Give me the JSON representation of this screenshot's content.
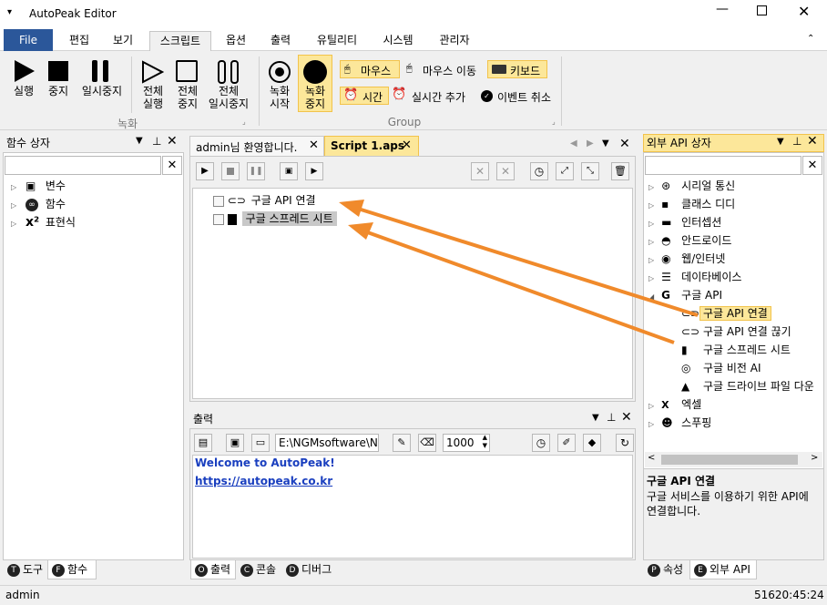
{
  "app": {
    "title": "AutoPeak Editor"
  },
  "menu": {
    "file": "File",
    "tabs": [
      "편집",
      "보기",
      "스크립트",
      "옵션",
      "출력",
      "유틸리티",
      "시스템",
      "관리자"
    ]
  },
  "ribbon": {
    "run": "실행",
    "stop": "중지",
    "pause": "일시중지",
    "run_all": [
      "전체",
      "실행"
    ],
    "stop_all": [
      "전체",
      "중지"
    ],
    "pause_all": [
      "전체",
      "일시중지"
    ],
    "record_start": [
      "녹화",
      "시작"
    ],
    "record_stop": [
      "녹화",
      "중지"
    ],
    "group_record": "녹화",
    "mouse": "마우스",
    "mouse_move": "마우스 이동",
    "keyboard": "키보드",
    "time": "시간",
    "realtime_add": "실시간 추가",
    "event_cancel": "이벤트 취소",
    "group_group": "Group"
  },
  "left_panel": {
    "title": "함수 상자",
    "items": [
      {
        "label": "변수"
      },
      {
        "label": "함수"
      },
      {
        "label": "표현식"
      }
    ],
    "tabs": {
      "tools": "도구",
      "functions": "함수",
      "tools_key": "T",
      "functions_key": "F"
    }
  },
  "editor": {
    "tabs": [
      "admin님 환영합니다.",
      "Script 1.aps"
    ],
    "items": [
      "구글 API 연결",
      "구글 스프레드 시트"
    ]
  },
  "output": {
    "title": "출력",
    "path": "E:\\NGMsoftware\\NG",
    "value": "1000",
    "welcome": "Welcome to AutoPeak!",
    "link": "https://autopeak.co.kr",
    "tabs": [
      {
        "key": "O",
        "label": "출력"
      },
      {
        "key": "C",
        "label": "콘솔"
      },
      {
        "key": "D",
        "label": "디버그"
      }
    ]
  },
  "right_panel": {
    "title": "외부 API 상자",
    "items": [
      {
        "label": "시리얼 통신",
        "icon": "serial-icon"
      },
      {
        "label": "클래스 디디",
        "icon": "class-icon"
      },
      {
        "label": "인터셉션",
        "icon": "monitor-icon"
      },
      {
        "label": "안드로이드",
        "icon": "android-icon"
      },
      {
        "label": "웹/인터넷",
        "icon": "web-icon"
      },
      {
        "label": "데이타베이스",
        "icon": "database-icon"
      },
      {
        "label": "구글 API",
        "icon": "google-icon"
      }
    ],
    "google_children": [
      "구글 API 연결",
      "구글 API 연결 끊기",
      "구글 스프레드 시트",
      "구글 비전 AI",
      "구글 드라이브 파일 다운"
    ],
    "items_after": [
      {
        "label": "엑셀",
        "icon": "excel-icon"
      },
      {
        "label": "스푸핑",
        "icon": "spoofing-icon"
      }
    ],
    "desc_title": "구글 API 연결",
    "desc_body": "구글 서비스를 이용하기 위한 API에 연결합니다.",
    "tabs": {
      "props_key": "P",
      "props": "속성",
      "api_key": "E",
      "api": "외부 API"
    }
  },
  "statusbar": {
    "user": "admin",
    "coords": "51620:45:24"
  },
  "colors": {
    "accent": "#2b579a",
    "highlight": "#fce79a",
    "arrow": "#f08a2b"
  }
}
